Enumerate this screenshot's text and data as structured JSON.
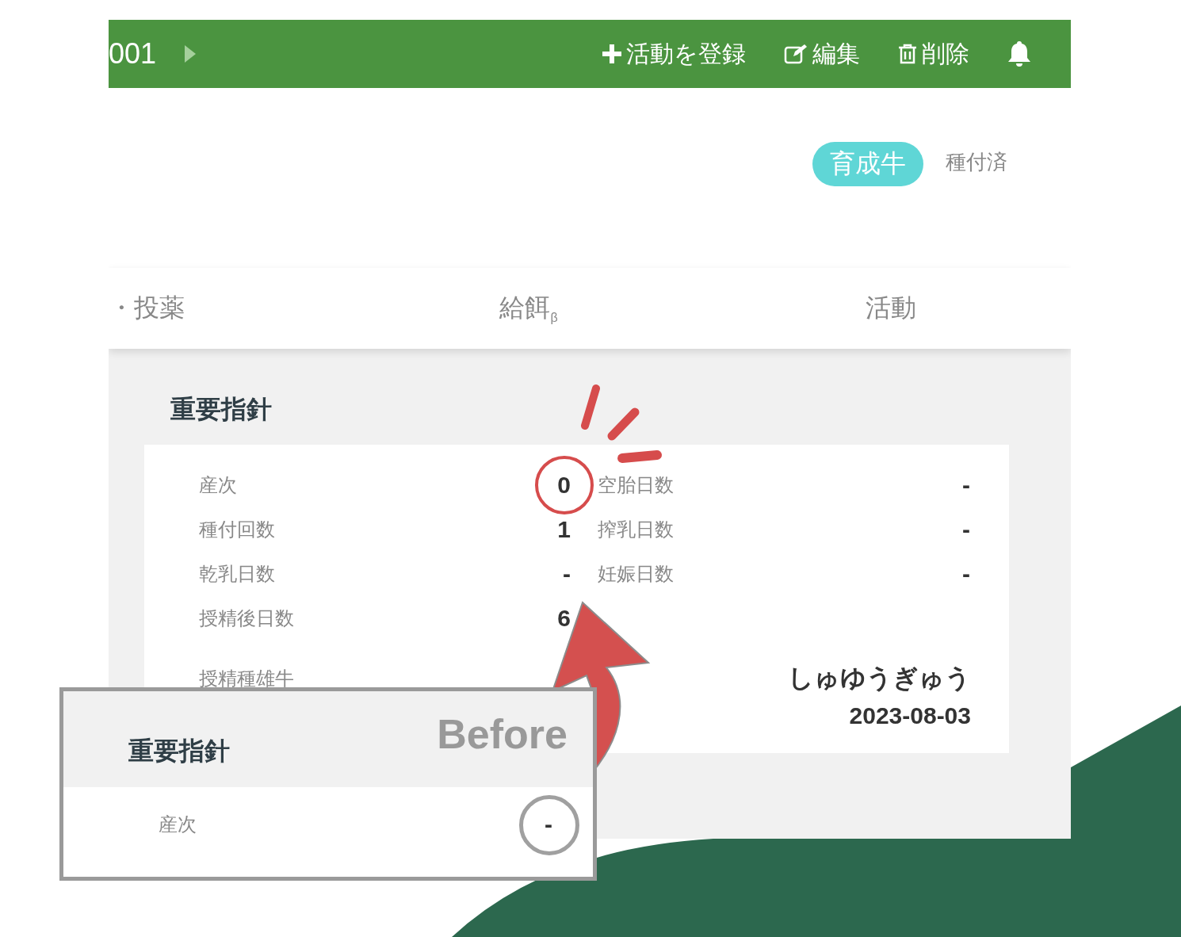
{
  "header": {
    "title": "001",
    "actions": [
      {
        "kind": "add",
        "label": "活動を登録"
      },
      {
        "kind": "edit",
        "label": "編集"
      },
      {
        "kind": "delete",
        "label": "削除"
      }
    ]
  },
  "tags": [
    {
      "label": "育成牛",
      "selected": true
    },
    {
      "label": "種付済",
      "selected": false
    }
  ],
  "tabs": [
    {
      "label": "・投薬"
    },
    {
      "label": "給餌$_{β}$"
    },
    {
      "label": "活動"
    }
  ],
  "section": {
    "title": "重要指針",
    "indicators": [
      {
        "label": "産次",
        "value": "0",
        "circled": true
      },
      {
        "label": "空胎日数",
        "value": "-",
        "circled": false
      },
      {
        "label": "種付回数",
        "value": "1",
        "circled": false
      },
      {
        "label": "搾乳日数",
        "value": "-",
        "circled": false
      },
      {
        "label": "乾乳日数",
        "value": "-",
        "circled": false
      },
      {
        "label": "妊娠日数",
        "value": "-",
        "circled": false
      },
      {
        "label": "授精後日数",
        "value": "6",
        "circled": false
      }
    ],
    "bull": {
      "label": "授精種雄牛",
      "value": "しゅゆうぎゅう"
    },
    "date": "2023-08-03"
  },
  "before_inset": {
    "caption": "Before",
    "title": "重要指針",
    "rows": [
      {
        "label": "産次",
        "value": "-",
        "circled": true
      }
    ]
  }
}
